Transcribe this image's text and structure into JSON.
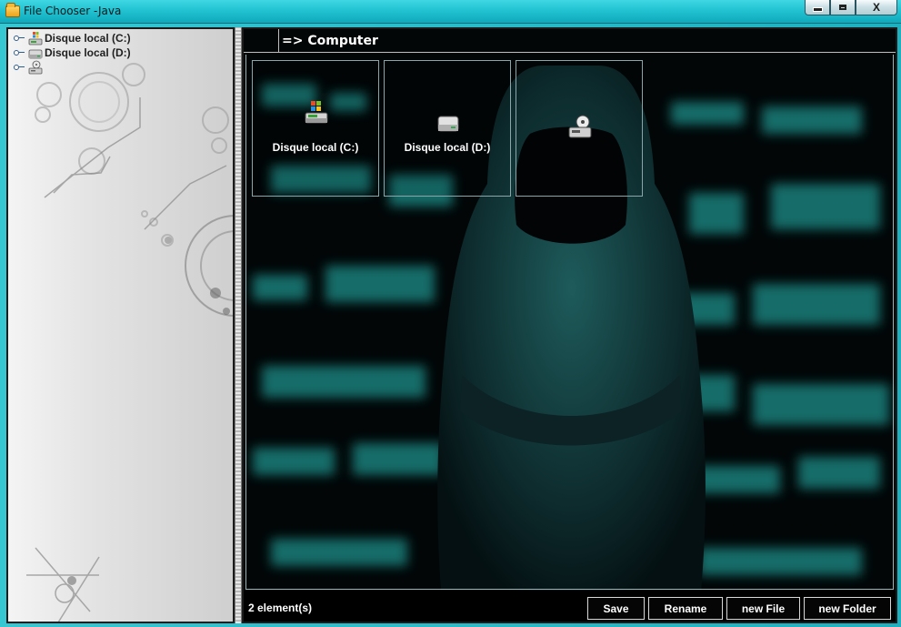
{
  "window": {
    "title": "File Chooser -Java",
    "controls": {
      "minimize": "",
      "maximize": "",
      "close": "X"
    }
  },
  "tree": {
    "items": [
      {
        "label": "Disque local (C:)",
        "icon": "windows-drive-icon"
      },
      {
        "label": "Disque local (D:)",
        "icon": "drive-icon"
      },
      {
        "label": "",
        "icon": "cd-drive-icon"
      }
    ]
  },
  "path_bar": {
    "text": "=> Computer"
  },
  "files": [
    {
      "label": "Disque local (C:)",
      "icon": "windows-drive-icon"
    },
    {
      "label": "Disque local (D:)",
      "icon": "drive-icon"
    },
    {
      "label": "",
      "icon": "cd-drive-icon"
    }
  ],
  "status": {
    "count_text": "2 element(s)"
  },
  "buttons": {
    "save": "Save",
    "rename": "Rename",
    "new_file": "new File",
    "new_folder": "new Folder"
  },
  "colors": {
    "titlebar": "#22c3d2",
    "frame": "#1fb0bf",
    "pane_bg": "#000000",
    "matrix_teal": "#1e8f8a",
    "text_light": "#ffffff"
  }
}
